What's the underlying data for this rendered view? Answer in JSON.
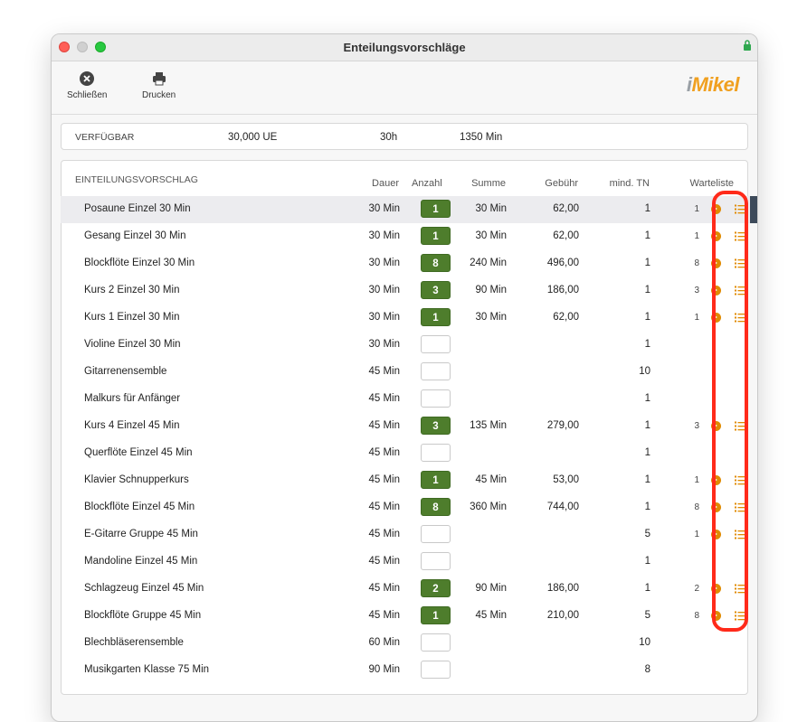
{
  "window": {
    "title": "Enteilungsvorschläge"
  },
  "toolbar": {
    "close_label": "Schließen",
    "print_label": "Drucken"
  },
  "logo": {
    "prefix": "i",
    "text": "Mikel"
  },
  "available": {
    "label": "VERFÜGBAR",
    "ue": "30,000 UE",
    "hours": "30h",
    "minutes": "1350 Min"
  },
  "table": {
    "title": "EINTEILUNGSVORSCHLAG",
    "columns": {
      "dauer": "Dauer",
      "anzahl": "Anzahl",
      "summe": "Summe",
      "gebuehr": "Gebühr",
      "mindtn": "mind. TN",
      "warteliste": "Warteliste"
    },
    "rows": [
      {
        "name": "Posaune Einzel 30 Min",
        "dauer": "30 Min",
        "anzahl": "1",
        "summe": "30 Min",
        "gebuehr": "62,00",
        "mindtn": "1",
        "warteliste": "1",
        "selected": true
      },
      {
        "name": "Gesang Einzel 30 Min",
        "dauer": "30 Min",
        "anzahl": "1",
        "summe": "30 Min",
        "gebuehr": "62,00",
        "mindtn": "1",
        "warteliste": "1"
      },
      {
        "name": "Blockflöte Einzel 30 Min",
        "dauer": "30 Min",
        "anzahl": "8",
        "summe": "240 Min",
        "gebuehr": "496,00",
        "mindtn": "1",
        "warteliste": "8"
      },
      {
        "name": "Kurs 2 Einzel 30 Min",
        "dauer": "30 Min",
        "anzahl": "3",
        "summe": "90 Min",
        "gebuehr": "186,00",
        "mindtn": "1",
        "warteliste": "3"
      },
      {
        "name": "Kurs 1 Einzel 30 Min",
        "dauer": "30 Min",
        "anzahl": "1",
        "summe": "30 Min",
        "gebuehr": "62,00",
        "mindtn": "1",
        "warteliste": "1"
      },
      {
        "name": "Violine Einzel 30 Min",
        "dauer": "30 Min",
        "anzahl": "",
        "summe": "",
        "gebuehr": "",
        "mindtn": "1",
        "warteliste": ""
      },
      {
        "name": "Gitarrenensemble",
        "dauer": "45 Min",
        "anzahl": "",
        "summe": "",
        "gebuehr": "",
        "mindtn": "10",
        "warteliste": ""
      },
      {
        "name": "Malkurs für Anfänger",
        "dauer": "45 Min",
        "anzahl": "",
        "summe": "",
        "gebuehr": "",
        "mindtn": "1",
        "warteliste": ""
      },
      {
        "name": "Kurs 4 Einzel 45 Min",
        "dauer": "45 Min",
        "anzahl": "3",
        "summe": "135 Min",
        "gebuehr": "279,00",
        "mindtn": "1",
        "warteliste": "3"
      },
      {
        "name": "Querflöte Einzel 45 Min",
        "dauer": "45 Min",
        "anzahl": "",
        "summe": "",
        "gebuehr": "",
        "mindtn": "1",
        "warteliste": ""
      },
      {
        "name": "Klavier Schnupperkurs",
        "dauer": "45 Min",
        "anzahl": "1",
        "summe": "45 Min",
        "gebuehr": "53,00",
        "mindtn": "1",
        "warteliste": "1"
      },
      {
        "name": "Blockflöte Einzel 45 Min",
        "dauer": "45 Min",
        "anzahl": "8",
        "summe": "360 Min",
        "gebuehr": "744,00",
        "mindtn": "1",
        "warteliste": "8"
      },
      {
        "name": "E-Gitarre Gruppe 45 Min",
        "dauer": "45 Min",
        "anzahl": "",
        "summe": "",
        "gebuehr": "",
        "mindtn": "5",
        "warteliste": "1"
      },
      {
        "name": "Mandoline Einzel 45 Min",
        "dauer": "45 Min",
        "anzahl": "",
        "summe": "",
        "gebuehr": "",
        "mindtn": "1",
        "warteliste": ""
      },
      {
        "name": "Schlagzeug Einzel 45 Min",
        "dauer": "45 Min",
        "anzahl": "2",
        "summe": "90 Min",
        "gebuehr": "186,00",
        "mindtn": "1",
        "warteliste": "2"
      },
      {
        "name": "Blockflöte Gruppe 45 Min",
        "dauer": "45 Min",
        "anzahl": "1",
        "summe": "45 Min",
        "gebuehr": "210,00",
        "mindtn": "5",
        "warteliste": "8"
      },
      {
        "name": "Blechbläserensemble",
        "dauer": "60 Min",
        "anzahl": "",
        "summe": "",
        "gebuehr": "",
        "mindtn": "10",
        "warteliste": ""
      },
      {
        "name": "Musikgarten Klasse 75 Min",
        "dauer": "90 Min",
        "anzahl": "",
        "summe": "",
        "gebuehr": "",
        "mindtn": "8",
        "warteliste": ""
      }
    ]
  },
  "colors": {
    "accent_green": "#4e7d2c",
    "waitlist_orange": "#e08a00",
    "highlight_red": "#ff2a1a"
  }
}
